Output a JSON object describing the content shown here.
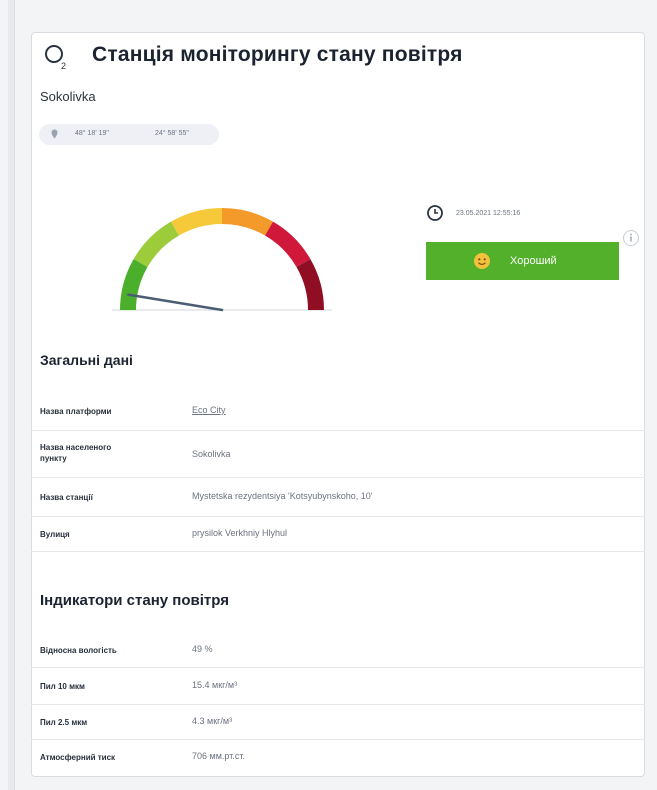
{
  "header": {
    "title": "Станція моніторингу стану повітря",
    "location": "Sokolivka"
  },
  "coordinates": {
    "latitude": "48° 18' 19\"",
    "longitude": "24° 58' 55\""
  },
  "status": {
    "timestamp": "23.05.2021 12:55:16",
    "label": "Хороший",
    "color": "#52b02a"
  },
  "gauge": {
    "level": 0.02,
    "colors": [
      "#4caf2b",
      "#9ccc3a",
      "#f5c93a",
      "#f39a2a",
      "#d0193a",
      "#8f0e23"
    ]
  },
  "general": {
    "title": "Загальні дані",
    "rows": [
      {
        "label": "Назва платформи",
        "value": "Eco City"
      },
      {
        "label": "Назва населеного пункту",
        "value": "Sokolivka"
      },
      {
        "label": "Назва станції",
        "value": "Mystetska rezydentsiya 'Kotsyubynskoho, 10'"
      },
      {
        "label": "Вулиця",
        "value": "prysilok Verkhniy Hlyhul"
      }
    ]
  },
  "indicators": {
    "title": "Індикатори стану повітря",
    "rows": [
      {
        "label": "Відносна вологість",
        "value": "49 %"
      },
      {
        "label": "Пил 10 мкм",
        "value": "15.4 мкг/м³"
      },
      {
        "label": "Пил 2.5 мкм",
        "value": "4.3 мкг/м³"
      },
      {
        "label": "Атмосферний тиск",
        "value": "706 мм.рт.ст."
      }
    ]
  },
  "icons": {
    "logo": "o2-logo-icon",
    "pin": "location-pin-icon",
    "clock": "clock-icon",
    "info": "info-icon",
    "face": "smiley-face-icon"
  }
}
